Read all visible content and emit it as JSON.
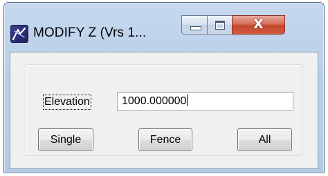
{
  "window": {
    "title": "MODIFY Z (Vrs 1...",
    "app_icon": "microstation-logo-icon",
    "caption_buttons": {
      "minimize": "minimize-icon",
      "maximize": "maximize-icon",
      "close": "X"
    }
  },
  "form": {
    "elevation_label": "Elevation",
    "elevation_value": "1000.000000"
  },
  "buttons": {
    "single": "Single",
    "fence": "Fence",
    "all": "All"
  },
  "colors": {
    "title_bar": "#bcd2ea",
    "close_button": "#c2452c",
    "client_background": "#f0f0f0"
  }
}
